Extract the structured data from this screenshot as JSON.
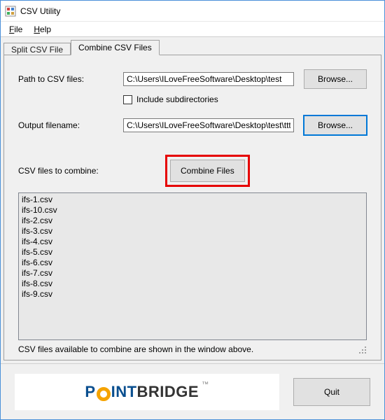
{
  "window": {
    "title": "CSV Utility"
  },
  "menu": {
    "file": "File",
    "file_accel": "F",
    "help": "Help",
    "help_accel": "H"
  },
  "tabs": {
    "split": "Split CSV File",
    "combine": "Combine CSV Files",
    "active": "combine"
  },
  "form": {
    "path_label": "Path to CSV files:",
    "path_value": "C:\\Users\\ILoveFreeSoftware\\Desktop\\test",
    "browse_label": "Browse...",
    "include_sub_label": "Include subdirectories",
    "include_sub_checked": false,
    "output_label": "Output filename:",
    "output_value": "C:\\Users\\ILoveFreeSoftware\\Desktop\\test\\ttttttt.csv",
    "combine_list_label": "CSV files to combine:",
    "combine_button": "Combine Files",
    "status_text": "CSV files available to combine are shown in the window above."
  },
  "files": [
    "ifs-1.csv",
    "ifs-10.csv",
    "ifs-2.csv",
    "ifs-3.csv",
    "ifs-4.csv",
    "ifs-5.csv",
    "ifs-6.csv",
    "ifs-7.csv",
    "ifs-8.csv",
    "ifs-9.csv"
  ],
  "footer": {
    "logo_point": "P",
    "logo_int": "INT",
    "logo_bridge": "BRIDGE",
    "logo_tm": "™",
    "quit": "Quit"
  },
  "colors": {
    "accent": "#0078d7",
    "highlight_red": "#e60000",
    "logo_orange": "#f5a300",
    "logo_blue": "#0a4f8f"
  }
}
